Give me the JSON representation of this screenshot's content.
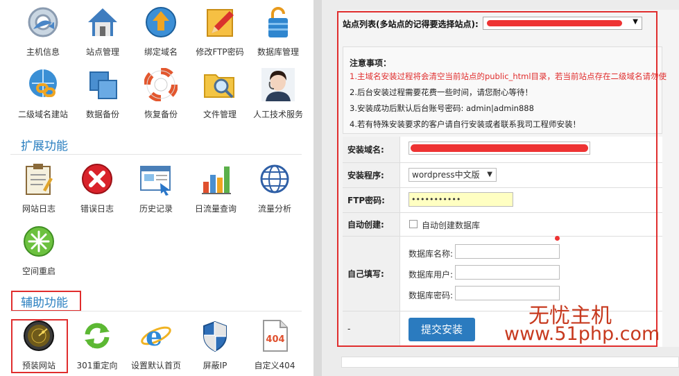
{
  "left": {
    "row1": [
      {
        "label": "主机信息",
        "icon": "host-info-icon"
      },
      {
        "label": "站点管理",
        "icon": "home-icon"
      },
      {
        "label": "绑定域名",
        "icon": "bind-domain-icon"
      },
      {
        "label": "修改FTP密码",
        "icon": "ftp-pencil-icon"
      },
      {
        "label": "数据库管理",
        "icon": "database-lock-icon"
      }
    ],
    "row2": [
      {
        "label": "二级域名建站",
        "icon": "subdomain-icon"
      },
      {
        "label": "数据备份",
        "icon": "backup-icon"
      },
      {
        "label": "恢复备份",
        "icon": "lifebuoy-icon"
      },
      {
        "label": "文件管理",
        "icon": "folder-search-icon"
      },
      {
        "label": "人工技术服务",
        "icon": "support-agent-icon"
      }
    ],
    "ext_title": "扩展功能",
    "row3": [
      {
        "label": "网站日志",
        "icon": "clipboard-log-icon"
      },
      {
        "label": "错误日志",
        "icon": "error-x-icon"
      },
      {
        "label": "历史记录",
        "icon": "history-window-icon"
      },
      {
        "label": "日流量查询",
        "icon": "bar-chart-icon"
      },
      {
        "label": "流量分析",
        "icon": "globe-icon"
      }
    ],
    "row4": [
      {
        "label": "空间重启",
        "icon": "restart-burst-icon"
      }
    ],
    "aux_title": "辅助功能",
    "row5": [
      {
        "label": "预装网站",
        "icon": "radar-icon"
      },
      {
        "label": "301重定向",
        "icon": "refresh-arrows-icon"
      },
      {
        "label": "设置默认首页",
        "icon": "ie-logo-icon"
      },
      {
        "label": "屏蔽IP",
        "icon": "shield-icon"
      },
      {
        "label": "自定义404",
        "icon": "page-404-icon"
      }
    ],
    "page404_text": "404"
  },
  "right": {
    "site_label": "站点列表(多站点的记得要选择站点):",
    "notice_title": "注意事项：",
    "notices": [
      "1.主域名安装过程将会清空当前站点的public_html目录，若当前站点存在二级域名请勿使",
      "2.后台安装过程需要花费一些时间，请您耐心等待！",
      "3.安装成功后默认后台账号密码: admin|admin888",
      "4.若有特殊安装要求的客户请自行安装或者联系我司工程师安装！"
    ],
    "domain_label": "安装域名:",
    "program_label": "安装程序:",
    "program_value": "wordpress中文版",
    "ftp_label": "FTP密码:",
    "ftp_value": "•••••••••••",
    "auto_label": "自动创建:",
    "auto_checkbox_label": "自动创建数据库",
    "self_label": "自己填写:",
    "db_name_label": "数据库名称:",
    "db_user_label": "数据库用户:",
    "db_pass_label": "数据库密码:",
    "dash": "-",
    "submit": "提交安装",
    "colors": {
      "notice_red": "#e02d2d",
      "accent_blue": "#2b7bbf",
      "watermark": "#c73a1f"
    }
  },
  "watermark": {
    "line1": "无忧主机",
    "line2": "www.51php.com"
  }
}
